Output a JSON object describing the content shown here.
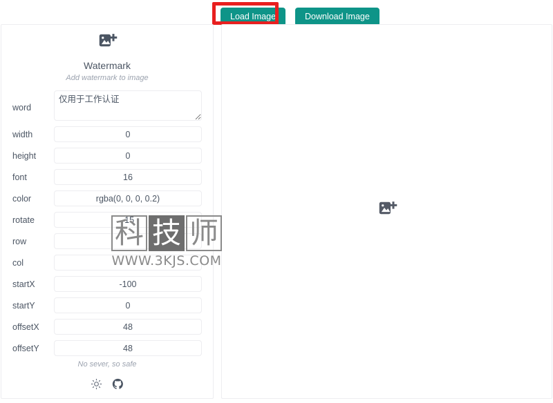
{
  "toolbar": {
    "load_label": "Load Image",
    "download_label": "Download Image",
    "accent_color": "#0e9488"
  },
  "annotation": {
    "highlight_color": "#e81f1f",
    "arrow_icon": "up-arrow-icon",
    "target": "Load Image"
  },
  "sidebar": {
    "icon": "add-image-icon",
    "title": "Watermark",
    "subtitle": "Add watermark to image",
    "fields": [
      {
        "label": "word",
        "value": "仅用于工作认证",
        "type": "textarea"
      },
      {
        "label": "width",
        "value": "0",
        "type": "input"
      },
      {
        "label": "height",
        "value": "0",
        "type": "input"
      },
      {
        "label": "font",
        "value": "16",
        "type": "input"
      },
      {
        "label": "color",
        "value": "rgba(0, 0, 0, 0.2)",
        "type": "input"
      },
      {
        "label": "rotate",
        "value": "-15",
        "type": "input"
      },
      {
        "label": "row",
        "value": "",
        "type": "input"
      },
      {
        "label": "col",
        "value": "",
        "type": "input"
      },
      {
        "label": "startX",
        "value": "-100",
        "type": "input"
      },
      {
        "label": "startY",
        "value": "0",
        "type": "input"
      },
      {
        "label": "offsetX",
        "value": "48",
        "type": "input"
      },
      {
        "label": "offsetY",
        "value": "48",
        "type": "input"
      }
    ],
    "footer": {
      "note": "No sever, so safe",
      "theme_icon": "sun-icon",
      "github_icon": "github-icon"
    }
  },
  "preview": {
    "placeholder_icon": "add-image-icon"
  },
  "site_watermark": {
    "chars": [
      "科",
      "技",
      "师"
    ],
    "filled_index": 1,
    "url": "WWW.3KJS.COM"
  }
}
